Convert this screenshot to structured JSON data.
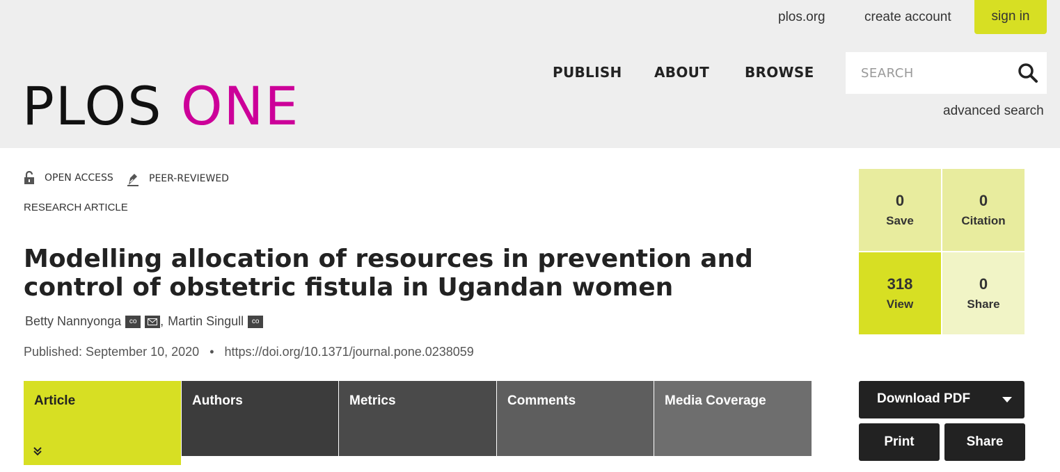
{
  "header": {
    "links": {
      "plos_org": "plos.org",
      "create_account": "create account",
      "sign_in": "sign in"
    },
    "logo": {
      "plos": "PLOS",
      "one": "ONE"
    },
    "nav": {
      "publish": "PUBLISH",
      "about": "ABOUT",
      "browse": "BROWSE"
    },
    "search": {
      "placeholder": "SEARCH",
      "advanced": "advanced search"
    }
  },
  "article": {
    "badges": {
      "open_access": "OPEN ACCESS",
      "peer_reviewed": "PEER-REVIEWED"
    },
    "type": "RESEARCH ARTICLE",
    "title": "Modelling allocation of resources in prevention and control of obstetric fistula in Ugandan women",
    "authors": [
      {
        "name": "Betty Nannyonga",
        "separator": ","
      },
      {
        "name": "Martin Singull"
      }
    ],
    "author_icon_label": "co",
    "published": "Published: September 10, 2020",
    "dot": "•",
    "doi": "https://doi.org/10.1371/journal.pone.0238059"
  },
  "tabs": {
    "article": "Article",
    "authors": "Authors",
    "metrics": "Metrics",
    "comments": "Comments",
    "media": "Media Coverage"
  },
  "metrics": {
    "save": {
      "value": "0",
      "label": "Save"
    },
    "citation": {
      "value": "0",
      "label": "Citation"
    },
    "view": {
      "value": "318",
      "label": "View"
    },
    "share": {
      "value": "0",
      "label": "Share"
    }
  },
  "actions": {
    "download_pdf": "Download PDF",
    "print": "Print",
    "share": "Share"
  },
  "colors": {
    "accent": "#d7df23",
    "brand_magenta": "#cc0099",
    "header_bg": "#eeeeee"
  }
}
